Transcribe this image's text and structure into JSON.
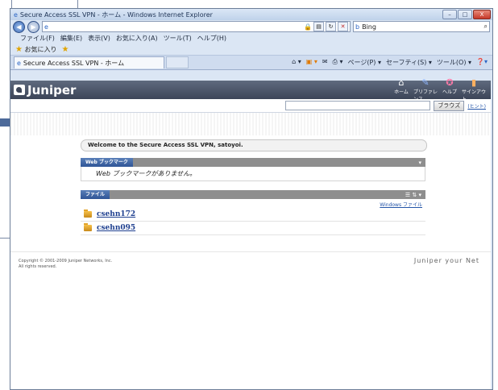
{
  "window": {
    "title": "Secure Access SSL VPN - ホーム - Windows Internet Explorer",
    "controls": [
      "–",
      "□",
      "X"
    ]
  },
  "address_bar": {
    "url": "",
    "search_placeholder": "Bing"
  },
  "menu": [
    "ファイル(F)",
    "編集(E)",
    "表示(V)",
    "お気に入り(A)",
    "ツール(T)",
    "ヘルプ(H)"
  ],
  "favorites": {
    "label": "お気に入り"
  },
  "tab": {
    "label": "Secure Access SSL VPN - ホーム"
  },
  "command_bar": [
    "ページ(P) ▾",
    "セーフティ(S) ▾",
    "ツール(O) ▾"
  ],
  "portal": {
    "brand": "Juniper",
    "nav": [
      "ホーム",
      "プリファレンス",
      "ヘルプ",
      "サインアウト"
    ],
    "browse_button": "ブラウズ",
    "browse_link": "(ヒント)",
    "welcome": "Welcome to the Secure Access SSL VPN, satoyoi.",
    "bookmarks": {
      "title": "Web ブックマーク",
      "empty": "Web ブックマークがありません。"
    },
    "files": {
      "title": "ファイル",
      "windows_link": "Windows ファイル",
      "items": [
        "csehn172",
        "csehn095"
      ]
    },
    "footer": {
      "copyright": "Copyright © 2001-2009 Juniper Networks, Inc.",
      "rights": "All rights reserved.",
      "tagline": "Juniper your Net"
    }
  }
}
